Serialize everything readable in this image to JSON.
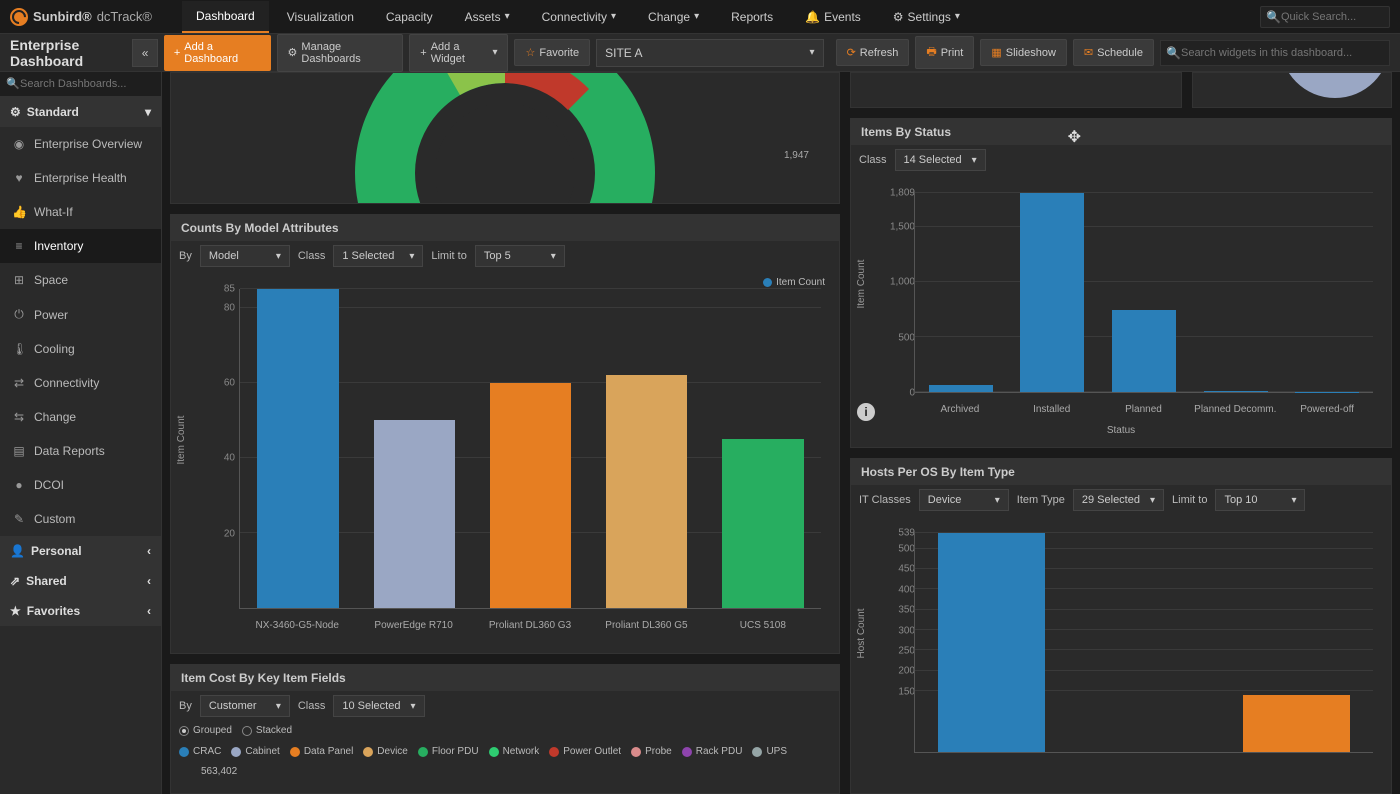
{
  "brand": {
    "name1": "Sunbird®",
    "name2": "dcTrack®"
  },
  "nav": {
    "items": [
      {
        "label": "Dashboard",
        "active": true,
        "caret": false
      },
      {
        "label": "Visualization",
        "caret": false
      },
      {
        "label": "Capacity",
        "caret": false
      },
      {
        "label": "Assets",
        "caret": true
      },
      {
        "label": "Connectivity",
        "caret": true
      },
      {
        "label": "Change",
        "caret": true
      },
      {
        "label": "Reports",
        "caret": false
      },
      {
        "label": "Events",
        "caret": false,
        "bell": true
      },
      {
        "label": "Settings",
        "caret": true,
        "gear": true
      }
    ],
    "quick_search_placeholder": "Quick Search..."
  },
  "toolbar": {
    "title": "Enterprise Dashboard",
    "add_dashboard": "Add a Dashboard",
    "manage": "Manage Dashboards",
    "add_widget": "Add a Widget",
    "favorite": "Favorite",
    "site": "SITE A",
    "refresh": "Refresh",
    "print": "Print",
    "slideshow": "Slideshow",
    "schedule": "Schedule",
    "search_placeholder": "Search widgets in this dashboard..."
  },
  "sidebar": {
    "search_placeholder": "Search Dashboards...",
    "sections": [
      {
        "label": "Standard",
        "expanded": true,
        "icon": "⚙"
      },
      {
        "label": "Personal",
        "expanded": false,
        "icon": "👤"
      },
      {
        "label": "Shared",
        "expanded": false,
        "icon": "↗"
      },
      {
        "label": "Favorites",
        "expanded": false,
        "icon": "★"
      }
    ],
    "items": [
      {
        "label": "Enterprise Overview",
        "icon": "◉"
      },
      {
        "label": "Enterprise Health",
        "icon": "♥"
      },
      {
        "label": "What-If",
        "icon": "👍"
      },
      {
        "label": "Inventory",
        "icon": "≡",
        "active": true
      },
      {
        "label": "Space",
        "icon": "⊞"
      },
      {
        "label": "Power",
        "icon": "⏻"
      },
      {
        "label": "Cooling",
        "icon": "🌡"
      },
      {
        "label": "Connectivity",
        "icon": "⇄"
      },
      {
        "label": "Change",
        "icon": "⇆"
      },
      {
        "label": "Data Reports",
        "icon": "▤"
      },
      {
        "label": "DCOI",
        "icon": "●"
      },
      {
        "label": "Custom",
        "icon": "✎"
      }
    ]
  },
  "donut_label": "1,947",
  "widgets": {
    "counts": {
      "title": "Counts By Model Attributes",
      "by_label": "By",
      "by_value": "Model",
      "class_label": "Class",
      "class_value": "1 Selected",
      "limit_label": "Limit to",
      "limit_value": "Top 5",
      "legend": "Item Count",
      "ylabel": "Item Count"
    },
    "status": {
      "title": "Items By Status",
      "class_label": "Class",
      "class_value": "14 Selected",
      "ylabel": "Item Count",
      "xlabel": "Status"
    },
    "hosts": {
      "title": "Hosts Per OS By Item Type",
      "it_label": "IT Classes",
      "it_value": "Device",
      "type_label": "Item Type",
      "type_value": "29 Selected",
      "limit_label": "Limit to",
      "limit_value": "Top 10",
      "ylabel": "Host Count"
    },
    "cost": {
      "title": "Item Cost By Key Item Fields",
      "by_label": "By",
      "by_value": "Customer",
      "class_label": "Class",
      "class_value": "10 Selected",
      "grouped": "Grouped",
      "stacked": "Stacked",
      "legend": [
        "CRAC",
        "Cabinet",
        "Data Panel",
        "Device",
        "Floor PDU",
        "Network",
        "Power Outlet",
        "Probe",
        "Rack PDU",
        "UPS"
      ],
      "legend_colors": [
        "#2a7fb8",
        "#9aa7c4",
        "#e67e22",
        "#d9a45b",
        "#27ae60",
        "#2ecc71",
        "#c0392b",
        "#d98b8b",
        "#8e44ad",
        "#95a5a6"
      ],
      "top_value": "563,402"
    }
  },
  "chart_data": [
    {
      "id": "counts",
      "type": "bar",
      "title": "Counts By Model Attributes",
      "categories": [
        "NX-3460-G5-Node",
        "PowerEdge R710",
        "Proliant DL360 G3",
        "Proliant DL360 G5",
        "UCS 5108"
      ],
      "values": [
        85,
        50,
        60,
        62,
        45
      ],
      "colors": [
        "#2a7fb8",
        "#9aa7c4",
        "#e67e22",
        "#d9a45b",
        "#27ae60"
      ],
      "ylabel": "Item Count",
      "ylim": [
        0,
        85
      ],
      "yticks": [
        20,
        40,
        60,
        80,
        85
      ]
    },
    {
      "id": "status",
      "type": "bar",
      "title": "Items By Status",
      "categories": [
        "Archived",
        "Installed",
        "Planned",
        "Planned Decomm.",
        "Powered-off"
      ],
      "values": [
        60,
        1809,
        750,
        5,
        3
      ],
      "colors": [
        "#2a7fb8",
        "#2a7fb8",
        "#2a7fb8",
        "#2a7fb8",
        "#2a7fb8"
      ],
      "ylabel": "Item Count",
      "xlabel": "Status",
      "ylim": [
        0,
        1809
      ],
      "yticks": [
        0,
        500,
        1000,
        1500,
        1809
      ]
    },
    {
      "id": "hosts",
      "type": "bar",
      "title": "Hosts Per OS By Item Type",
      "categories": [
        "",
        "",
        " "
      ],
      "values": [
        539,
        0,
        140
      ],
      "colors": [
        "#2a7fb8",
        "#2a7fb8",
        "#e67e22"
      ],
      "ylabel": "Host Count",
      "ylim": [
        0,
        539
      ],
      "yticks": [
        150,
        200,
        250,
        300,
        350,
        400,
        450,
        500,
        539
      ]
    }
  ]
}
